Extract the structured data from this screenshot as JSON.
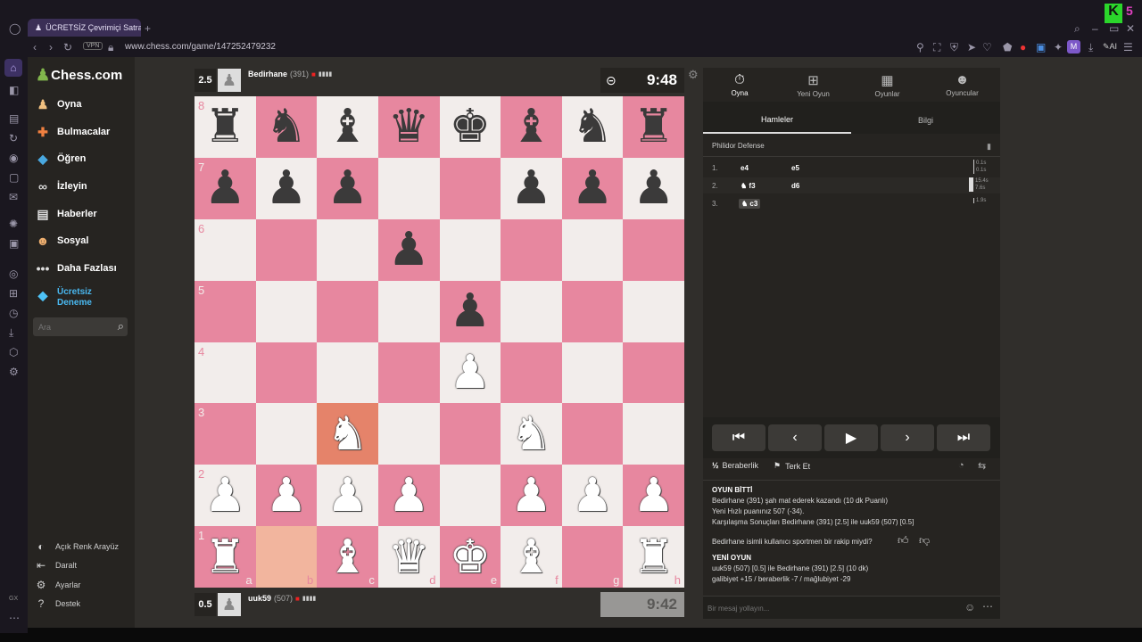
{
  "browser": {
    "tab_title": "ÜCRETSİZ Çevrimiçi Satran",
    "vpn_label": "VPN",
    "url": "www.chess.com/game/147252479232",
    "ai_label": "AI",
    "gx_label": "GX"
  },
  "sidebar": {
    "logo": "Chess.com",
    "items": [
      {
        "label": "Oyna",
        "icon": "pawn-icon"
      },
      {
        "label": "Bulmacalar",
        "icon": "puzzle-icon"
      },
      {
        "label": "Öğren",
        "icon": "graduation-icon"
      },
      {
        "label": "İzleyin",
        "icon": "binoculars-icon"
      },
      {
        "label": "Haberler",
        "icon": "newspaper-icon"
      },
      {
        "label": "Sosyal",
        "icon": "people-icon"
      },
      {
        "label": "Daha Fazlası",
        "icon": "more-icon"
      }
    ],
    "trial_label": "Ücretsiz\nDeneme",
    "search_placeholder": "Ara",
    "bottom": [
      {
        "label": "Açık Renk Arayüz",
        "icon": "contrast-icon"
      },
      {
        "label": "Daralt",
        "icon": "collapse-icon"
      },
      {
        "label": "Ayarlar",
        "icon": "gear-icon"
      },
      {
        "label": "Destek",
        "icon": "help-icon"
      }
    ]
  },
  "top_player": {
    "score": "2.5",
    "name": "Bedirhane",
    "rating": "(391)",
    "clock": "9:48"
  },
  "bottom_player": {
    "score": "0.5",
    "name": "uuk59",
    "rating": "(507)",
    "clock": "9:42"
  },
  "board": {
    "ranks": [
      "8",
      "7",
      "6",
      "5",
      "4",
      "3",
      "2",
      "1"
    ],
    "files": [
      "a",
      "b",
      "c",
      "d",
      "e",
      "f",
      "g",
      "h"
    ],
    "pieces": [
      "r",
      "n",
      "b",
      "q",
      "k",
      "b",
      "n",
      "r",
      "p",
      "p",
      "p",
      "",
      "",
      "p",
      "p",
      "p",
      "",
      "",
      "",
      "p",
      "",
      "",
      "",
      "",
      "",
      "",
      "",
      "",
      "p",
      "",
      "",
      "",
      "",
      "",
      "",
      "",
      "P",
      "",
      "",
      "",
      "",
      "",
      "N",
      "",
      "",
      "N",
      "",
      "",
      "P",
      "P",
      "P",
      "P",
      "",
      "P",
      "P",
      "P",
      "R",
      "",
      "B",
      "Q",
      "K",
      "B",
      "",
      "R"
    ],
    "highlight_from": "b1",
    "highlight_to": "c3"
  },
  "right_panel": {
    "tabs": [
      {
        "label": "Oyna",
        "icon": "clock-icon"
      },
      {
        "label": "Yeni Oyun",
        "icon": "plus-icon"
      },
      {
        "label": "Oyunlar",
        "icon": "board-icon"
      },
      {
        "label": "Oyuncular",
        "icon": "players-icon"
      }
    ],
    "subtabs": [
      "Hamleler",
      "Bilgi"
    ],
    "opening": "Philidor Defense",
    "moves": [
      {
        "num": "1.",
        "white": "e4",
        "black": "e5",
        "wt": "0.1s",
        "bt": "0.1s"
      },
      {
        "num": "2.",
        "white": "f3",
        "black": "d6",
        "wt": "15.4s",
        "bt": "7.6s"
      },
      {
        "num": "3.",
        "white": "c3",
        "black": "",
        "wt": "1.9s",
        "bt": ""
      }
    ],
    "draw_label": "Beraberlik",
    "resign_label": "Terk Et",
    "half_label": "½",
    "chat": {
      "over_title": "OYUN BİTTİ",
      "over_line1": "Bedirhane (391) şah mat ederek kazandı (10 dk Puanlı)",
      "over_line2": "Yeni Hızlı puanınız 507 (-34).",
      "over_line3": "Karşılaşma Sonuçları Bedirhane (391) [2.5] ile uuk59 (507) [0.5]",
      "sport_q": "Bedirhane isimli kullanıcı sportmen bir rakip miydi?",
      "new_title": "YENİ OYUN",
      "new_line1": "uuk59 (507) [0.5] ile Bedirhane (391) [2.5] (10 dk)",
      "new_line2": "galibiyet +15 / beraberlik -7 / mağlubiyet -29",
      "placeholder": "Bir mesaj yollayın..."
    }
  }
}
